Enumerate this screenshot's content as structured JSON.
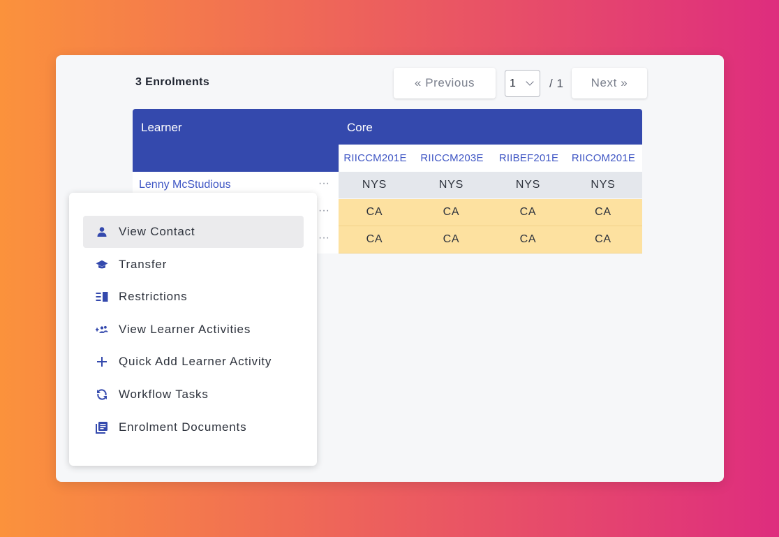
{
  "header": {
    "enrolment_count": "3 Enrolments",
    "previous_label": "« Previous",
    "next_label": "Next »",
    "page_current": "1",
    "page_total": "/ 1"
  },
  "table": {
    "col_learner": "Learner",
    "col_core": "Core",
    "units": [
      "RIICCM201E",
      "RIICCM203E",
      "RIIBEF201E",
      "RIICOM201E"
    ],
    "rows": [
      {
        "learner": "Lenny McStudious",
        "more": "···",
        "results": [
          "NYS",
          "NYS",
          "NYS",
          "NYS"
        ]
      },
      {
        "learner": "",
        "more": "···",
        "results": [
          "CA",
          "CA",
          "CA",
          "CA"
        ]
      },
      {
        "learner": "",
        "more": "···",
        "results": [
          "CA",
          "CA",
          "CA",
          "CA"
        ]
      }
    ]
  },
  "menu": {
    "items": [
      {
        "label": "View Contact",
        "icon": "person-icon"
      },
      {
        "label": "Transfer",
        "icon": "graduation-cap-icon"
      },
      {
        "label": "Restrictions",
        "icon": "restrictions-icon"
      },
      {
        "label": "View Learner Activities",
        "icon": "add-group-icon"
      },
      {
        "label": "Quick Add Learner Activity",
        "icon": "plus-icon"
      },
      {
        "label": "Workflow Tasks",
        "icon": "sync-icon"
      },
      {
        "label": "Enrolment Documents",
        "icon": "documents-icon"
      }
    ]
  },
  "colors": {
    "header_blue": "#3449ad",
    "link_blue": "#3f56c4",
    "nys_bg": "#e4e7ec",
    "ca_bg": "#fde1a0",
    "menu_active_bg": "#ebebed"
  }
}
